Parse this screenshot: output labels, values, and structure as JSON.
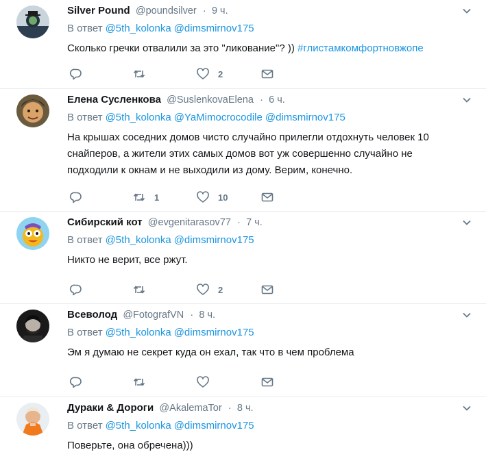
{
  "reply_prefix": "В ответ",
  "tweets": [
    {
      "name": "Silver Pound",
      "handle": "@poundsilver",
      "dot": "·",
      "time": "9 ч.",
      "mentions": [
        "@5th_kolonka",
        "@dimsmirnov175"
      ],
      "text": "Сколько гречки отвалили за это \"ликование\"? ))",
      "hashtag": "#глистамкомфортновжопе",
      "retweets": "",
      "likes": "2"
    },
    {
      "name": "Елена Сусленкова",
      "handle": "@SuslenkovaElena",
      "dot": "·",
      "time": "6 ч.",
      "mentions": [
        "@5th_kolonka",
        "@YaMimocrocodile",
        "@dimsmirnov175"
      ],
      "text_lines": [
        "На крышах соседних домов чисто случайно  прилегли отдохнуть человек 10",
        "снайперов, а жители этих самых домов вот уж совершенно случайно не",
        "подходили к окнам и не выходили из дому. Верим, конечно."
      ],
      "retweets": "1",
      "likes": "10"
    },
    {
      "name": "Сибирский кот",
      "handle": "@evgenitarasov77",
      "dot": "·",
      "time": "7 ч.",
      "mentions": [
        "@5th_kolonka",
        "@dimsmirnov175"
      ],
      "text": "Никто не верит, все ржут.",
      "retweets": "",
      "likes": "2"
    },
    {
      "name": "Всеволод",
      "handle": "@FotografVN",
      "dot": "·",
      "time": "8 ч.",
      "mentions": [
        "@5th_kolonka",
        "@dimsmirnov175"
      ],
      "text": "Эм я думаю не секрет куда он ехал, так что в чем проблема",
      "retweets": "",
      "likes": ""
    },
    {
      "name": "Дураки & Дороги",
      "handle": "@AkalemaTor",
      "dot": "·",
      "time": "8 ч.",
      "mentions": [
        "@5th_kolonka",
        "@dimsmirnov175"
      ],
      "text": "Поверьте, она обречена)))"
    }
  ],
  "icons": {
    "reply": "reply-icon",
    "retweet": "retweet-icon",
    "like": "heart-icon",
    "dm": "envelope-icon",
    "more": "chevron-down-icon"
  },
  "colors": {
    "link": "#1b95e0",
    "secondary": "#657786",
    "border": "#e6ecf0",
    "text": "#14171a"
  }
}
